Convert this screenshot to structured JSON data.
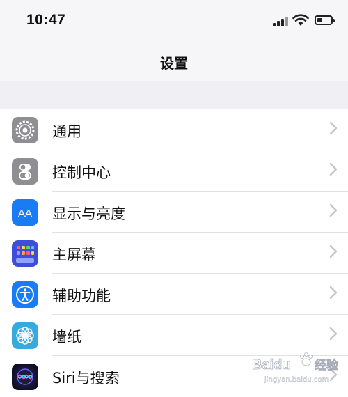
{
  "status": {
    "time": "10:47"
  },
  "nav": {
    "title": "设置"
  },
  "items": [
    {
      "label": "通用",
      "icon": "gear-icon",
      "color": "#8e8e93"
    },
    {
      "label": "控制中心",
      "icon": "toggles-icon",
      "color": "#8e8e93"
    },
    {
      "label": "显示与亮度",
      "icon": "text-size-icon",
      "color": "#1a7cf5"
    },
    {
      "label": "主屏幕",
      "icon": "app-grid-icon",
      "color": "#3d4fd8"
    },
    {
      "label": "辅助功能",
      "icon": "accessibility-icon",
      "color": "#1a7cf5"
    },
    {
      "label": "墙纸",
      "icon": "flower-icon",
      "color": "#36aadc"
    },
    {
      "label": "Siri与搜索",
      "icon": "siri-icon",
      "color": "#222"
    }
  ],
  "watermark": {
    "brand": "Baidu",
    "sub": "经验",
    "url": "jingyan.baidu.com"
  }
}
